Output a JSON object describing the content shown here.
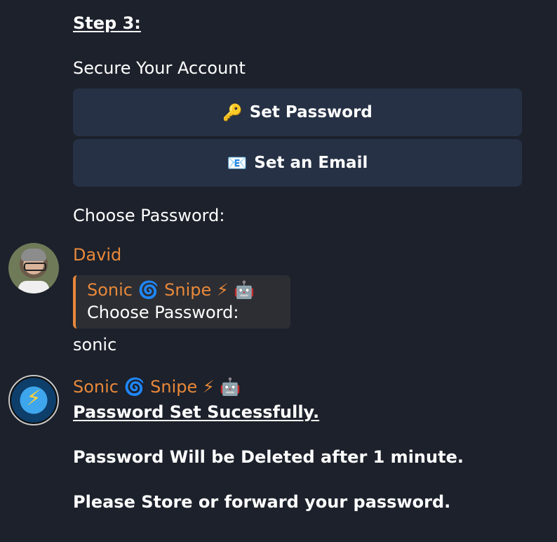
{
  "step": {
    "title": "Step 3:",
    "subtitle": "Secure Your Account"
  },
  "buttons": [
    {
      "emoji": "🔑",
      "label": "Set Password",
      "icon": "key-icon"
    },
    {
      "emoji": "📧",
      "label": "Set an Email",
      "icon": "email-icon"
    }
  ],
  "prompt": "Choose Password:",
  "messages": [
    {
      "sender": "David",
      "reply": {
        "sender": "Sonic 🌀 Snipe ⚡ 🤖",
        "text": "Choose Password:"
      },
      "text": "sonic"
    },
    {
      "sender": "Sonic 🌀 Snipe ⚡ 🤖",
      "lines": [
        "Password Set Sucessfully.",
        "Password Will be Deleted after 1 minute.",
        "Please Store or forward your password."
      ]
    }
  ],
  "colors": {
    "background": "#1c212b",
    "button": "#263145",
    "sender": "#e8883a",
    "reply_box": "#2c2e33"
  }
}
